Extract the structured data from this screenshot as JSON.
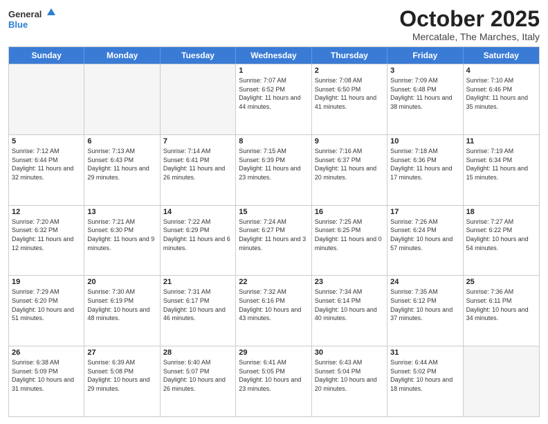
{
  "logo": {
    "general": "General",
    "blue": "Blue"
  },
  "header": {
    "title": "October 2025",
    "subtitle": "Mercatale, The Marches, Italy"
  },
  "days": [
    "Sunday",
    "Monday",
    "Tuesday",
    "Wednesday",
    "Thursday",
    "Friday",
    "Saturday"
  ],
  "rows": [
    [
      {
        "day": "",
        "empty": true
      },
      {
        "day": "",
        "empty": true
      },
      {
        "day": "",
        "empty": true
      },
      {
        "day": "1",
        "sunrise": "Sunrise: 7:07 AM",
        "sunset": "Sunset: 6:52 PM",
        "daylight": "Daylight: 11 hours and 44 minutes."
      },
      {
        "day": "2",
        "sunrise": "Sunrise: 7:08 AM",
        "sunset": "Sunset: 6:50 PM",
        "daylight": "Daylight: 11 hours and 41 minutes."
      },
      {
        "day": "3",
        "sunrise": "Sunrise: 7:09 AM",
        "sunset": "Sunset: 6:48 PM",
        "daylight": "Daylight: 11 hours and 38 minutes."
      },
      {
        "day": "4",
        "sunrise": "Sunrise: 7:10 AM",
        "sunset": "Sunset: 6:46 PM",
        "daylight": "Daylight: 11 hours and 35 minutes."
      }
    ],
    [
      {
        "day": "5",
        "sunrise": "Sunrise: 7:12 AM",
        "sunset": "Sunset: 6:44 PM",
        "daylight": "Daylight: 11 hours and 32 minutes."
      },
      {
        "day": "6",
        "sunrise": "Sunrise: 7:13 AM",
        "sunset": "Sunset: 6:43 PM",
        "daylight": "Daylight: 11 hours and 29 minutes."
      },
      {
        "day": "7",
        "sunrise": "Sunrise: 7:14 AM",
        "sunset": "Sunset: 6:41 PM",
        "daylight": "Daylight: 11 hours and 26 minutes."
      },
      {
        "day": "8",
        "sunrise": "Sunrise: 7:15 AM",
        "sunset": "Sunset: 6:39 PM",
        "daylight": "Daylight: 11 hours and 23 minutes."
      },
      {
        "day": "9",
        "sunrise": "Sunrise: 7:16 AM",
        "sunset": "Sunset: 6:37 PM",
        "daylight": "Daylight: 11 hours and 20 minutes."
      },
      {
        "day": "10",
        "sunrise": "Sunrise: 7:18 AM",
        "sunset": "Sunset: 6:36 PM",
        "daylight": "Daylight: 11 hours and 17 minutes."
      },
      {
        "day": "11",
        "sunrise": "Sunrise: 7:19 AM",
        "sunset": "Sunset: 6:34 PM",
        "daylight": "Daylight: 11 hours and 15 minutes."
      }
    ],
    [
      {
        "day": "12",
        "sunrise": "Sunrise: 7:20 AM",
        "sunset": "Sunset: 6:32 PM",
        "daylight": "Daylight: 11 hours and 12 minutes."
      },
      {
        "day": "13",
        "sunrise": "Sunrise: 7:21 AM",
        "sunset": "Sunset: 6:30 PM",
        "daylight": "Daylight: 11 hours and 9 minutes."
      },
      {
        "day": "14",
        "sunrise": "Sunrise: 7:22 AM",
        "sunset": "Sunset: 6:29 PM",
        "daylight": "Daylight: 11 hours and 6 minutes."
      },
      {
        "day": "15",
        "sunrise": "Sunrise: 7:24 AM",
        "sunset": "Sunset: 6:27 PM",
        "daylight": "Daylight: 11 hours and 3 minutes."
      },
      {
        "day": "16",
        "sunrise": "Sunrise: 7:25 AM",
        "sunset": "Sunset: 6:25 PM",
        "daylight": "Daylight: 11 hours and 0 minutes."
      },
      {
        "day": "17",
        "sunrise": "Sunrise: 7:26 AM",
        "sunset": "Sunset: 6:24 PM",
        "daylight": "Daylight: 10 hours and 57 minutes."
      },
      {
        "day": "18",
        "sunrise": "Sunrise: 7:27 AM",
        "sunset": "Sunset: 6:22 PM",
        "daylight": "Daylight: 10 hours and 54 minutes."
      }
    ],
    [
      {
        "day": "19",
        "sunrise": "Sunrise: 7:29 AM",
        "sunset": "Sunset: 6:20 PM",
        "daylight": "Daylight: 10 hours and 51 minutes."
      },
      {
        "day": "20",
        "sunrise": "Sunrise: 7:30 AM",
        "sunset": "Sunset: 6:19 PM",
        "daylight": "Daylight: 10 hours and 48 minutes."
      },
      {
        "day": "21",
        "sunrise": "Sunrise: 7:31 AM",
        "sunset": "Sunset: 6:17 PM",
        "daylight": "Daylight: 10 hours and 46 minutes."
      },
      {
        "day": "22",
        "sunrise": "Sunrise: 7:32 AM",
        "sunset": "Sunset: 6:16 PM",
        "daylight": "Daylight: 10 hours and 43 minutes."
      },
      {
        "day": "23",
        "sunrise": "Sunrise: 7:34 AM",
        "sunset": "Sunset: 6:14 PM",
        "daylight": "Daylight: 10 hours and 40 minutes."
      },
      {
        "day": "24",
        "sunrise": "Sunrise: 7:35 AM",
        "sunset": "Sunset: 6:12 PM",
        "daylight": "Daylight: 10 hours and 37 minutes."
      },
      {
        "day": "25",
        "sunrise": "Sunrise: 7:36 AM",
        "sunset": "Sunset: 6:11 PM",
        "daylight": "Daylight: 10 hours and 34 minutes."
      }
    ],
    [
      {
        "day": "26",
        "sunrise": "Sunrise: 6:38 AM",
        "sunset": "Sunset: 5:09 PM",
        "daylight": "Daylight: 10 hours and 31 minutes."
      },
      {
        "day": "27",
        "sunrise": "Sunrise: 6:39 AM",
        "sunset": "Sunset: 5:08 PM",
        "daylight": "Daylight: 10 hours and 29 minutes."
      },
      {
        "day": "28",
        "sunrise": "Sunrise: 6:40 AM",
        "sunset": "Sunset: 5:07 PM",
        "daylight": "Daylight: 10 hours and 26 minutes."
      },
      {
        "day": "29",
        "sunrise": "Sunrise: 6:41 AM",
        "sunset": "Sunset: 5:05 PM",
        "daylight": "Daylight: 10 hours and 23 minutes."
      },
      {
        "day": "30",
        "sunrise": "Sunrise: 6:43 AM",
        "sunset": "Sunset: 5:04 PM",
        "daylight": "Daylight: 10 hours and 20 minutes."
      },
      {
        "day": "31",
        "sunrise": "Sunrise: 6:44 AM",
        "sunset": "Sunset: 5:02 PM",
        "daylight": "Daylight: 10 hours and 18 minutes."
      },
      {
        "day": "",
        "empty": true
      }
    ]
  ]
}
